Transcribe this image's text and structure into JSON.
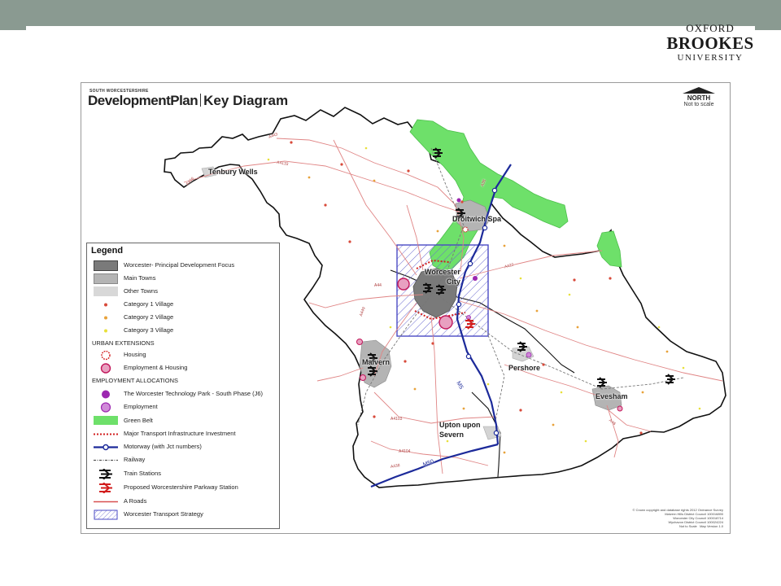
{
  "slide": {
    "logo": {
      "line1": "OXFORD",
      "line2": "BROOKES",
      "line3": "UNIVERSITY"
    }
  },
  "map": {
    "small_header": "SOUTH WORCESTERSHIRE",
    "title_part1": "DevelopmentPlan",
    "title_part2": "Key Diagram",
    "north_label": "NORTH",
    "scale_label": "Not to scale",
    "places": {
      "tenbury": "Tenbury Wells",
      "droitwich": "Droitwich Spa",
      "worcester": "Worcester\nCity",
      "malvern": "Malvern",
      "pershore": "Pershore",
      "upton": "Upton upon\nSevern",
      "evesham": "Evesham"
    },
    "roads": {
      "m5": "M5",
      "m50": "M50",
      "a443": "A443",
      "a456": "A456",
      "a4133": "A4133",
      "a38": "A38",
      "a449": "A449",
      "a44": "A44",
      "a422": "A422",
      "a4103": "A4103",
      "a4104": "A4104",
      "a438": "A438",
      "a46": "A46"
    },
    "copyright": "© Crown copyright and database rights 2012 Ordnance Survey\nMalvern Hills District Council 100016890\nWorcester City Council 100018714\nWychavon District Council 100024224\nNot to Scale   Map Version 1.0",
    "colors": {
      "green_belt": "#6ee06a",
      "principal_focus": "#7a7a7a",
      "main_towns": "#b4b4b4",
      "a_roads": "#e08585",
      "motorway": "#1c2a9a",
      "transport_strategy": "#4a4ac4"
    },
    "legend": {
      "title": "Legend",
      "items": [
        {
          "label": "Worcester- Principal Development Focus"
        },
        {
          "label": "Main Towns"
        },
        {
          "label": "Other Towns"
        },
        {
          "label": "Category 1 Village"
        },
        {
          "label": "Category 2 Village"
        },
        {
          "label": "Category 3 Village"
        },
        {
          "label": "URBAN EXTENSIONS"
        },
        {
          "label": "Housing"
        },
        {
          "label": "Employment & Housing"
        },
        {
          "label": "EMPLOYMENT ALLOCATIONS"
        },
        {
          "label": "The Worcester Technology Park - South Phase (J6)"
        },
        {
          "label": "Employment"
        },
        {
          "label": "Green Belt"
        },
        {
          "label": "Major Transport Infrastructure Investment"
        },
        {
          "label": "Motorway (with Jct numbers)"
        },
        {
          "label": "Railway"
        },
        {
          "label": "Train Stations"
        },
        {
          "label": "Proposed Worcestershire Parkway Station"
        },
        {
          "label": "A Roads"
        },
        {
          "label": "Worcester Transport Strategy"
        }
      ]
    }
  }
}
